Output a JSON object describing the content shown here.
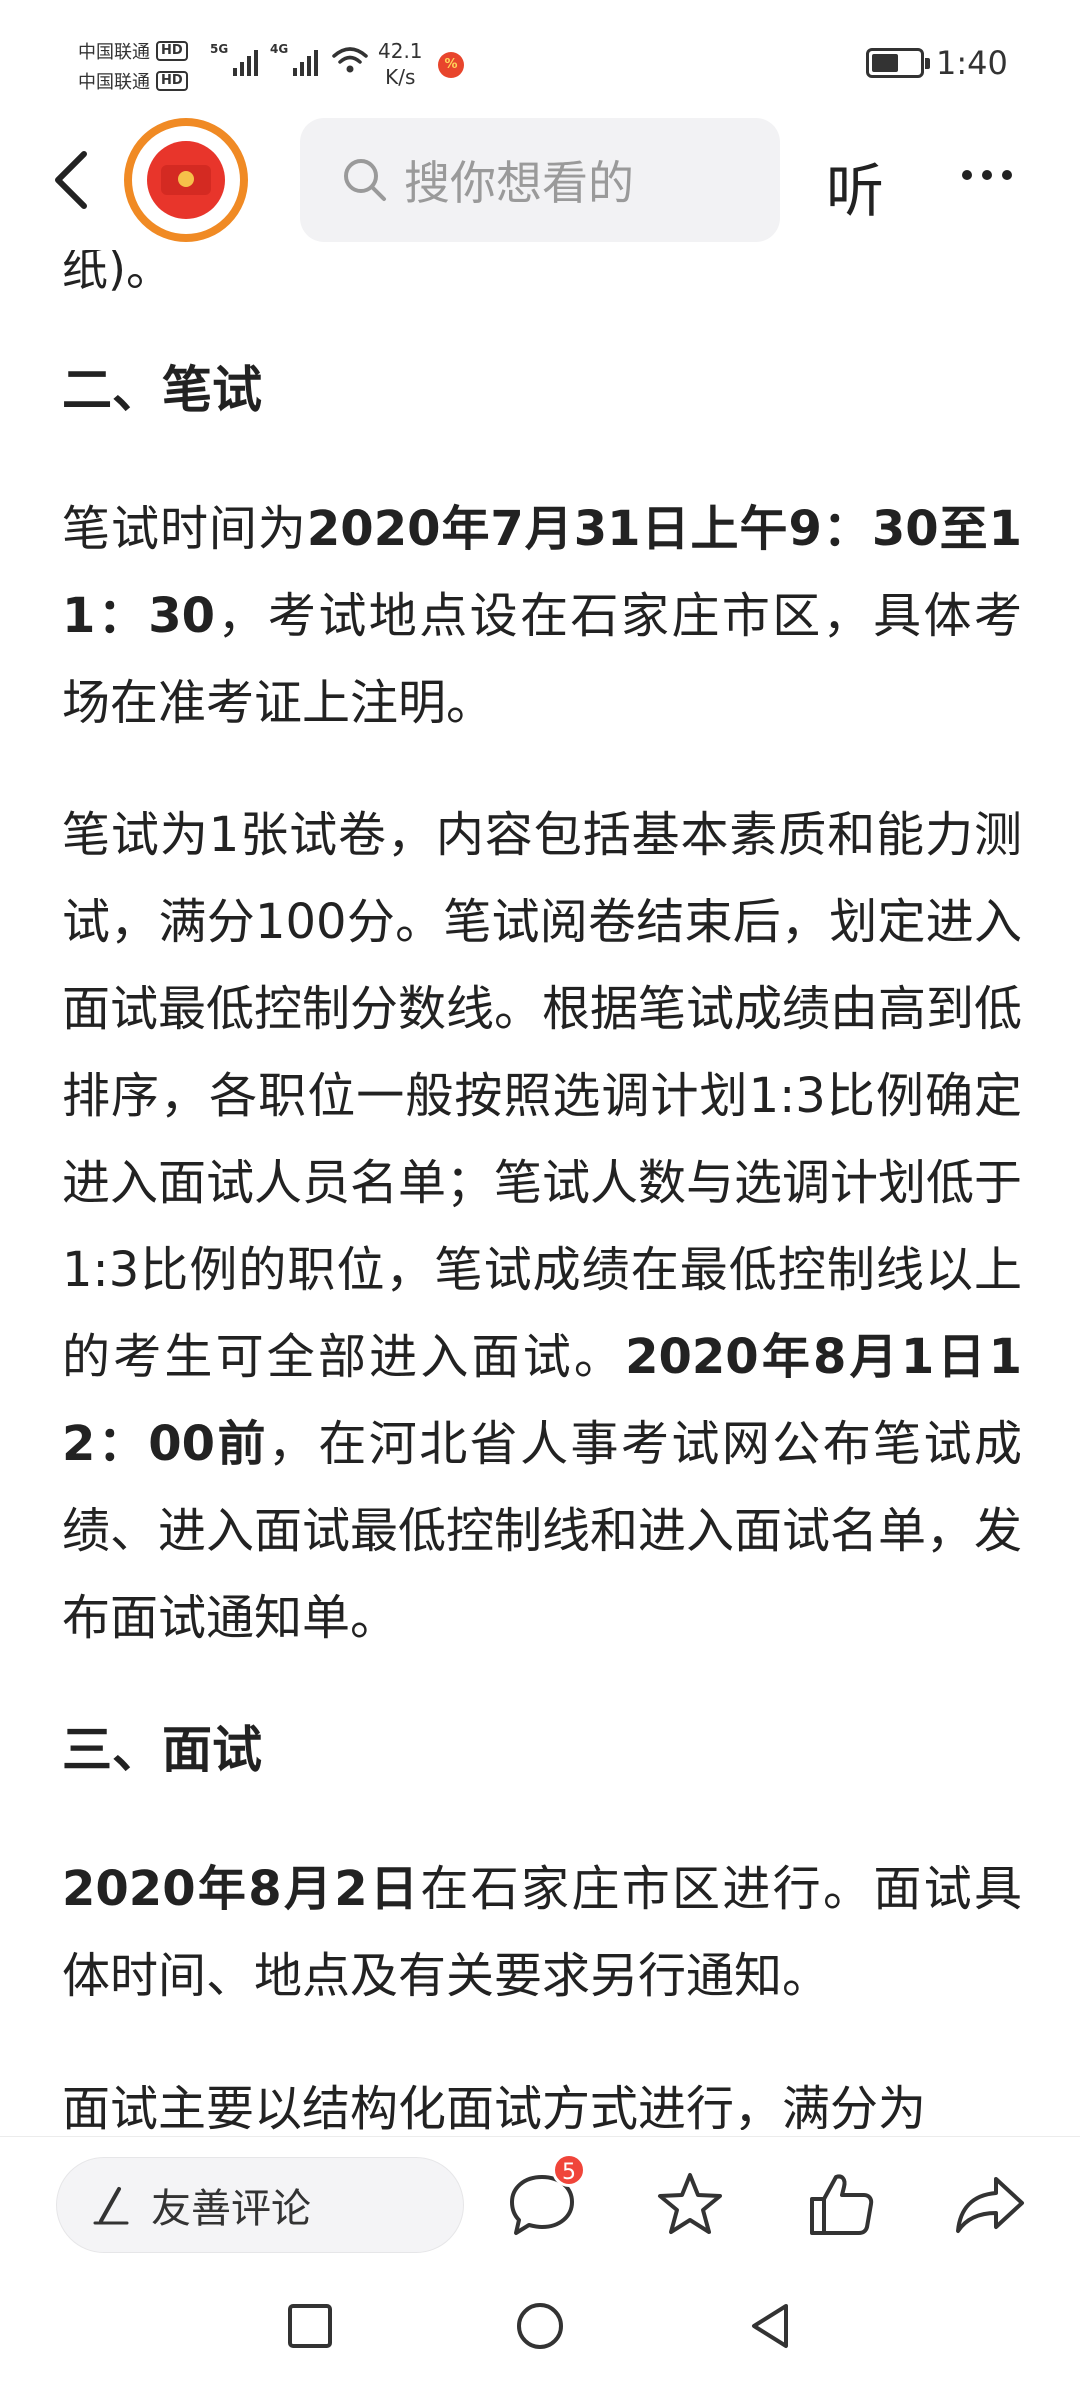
{
  "status_bar": {
    "carrier1": "中国联通",
    "carrier2": "中国联通",
    "hd": "HD",
    "sim1_tech": "5G",
    "sim2_tech": "4G",
    "net_speed_value": "42.1",
    "net_speed_unit": "K/s",
    "time": "1:40"
  },
  "nav": {
    "search_placeholder": "搜你想看的",
    "listen_label": "听"
  },
  "article": {
    "partial_top": "纸)。",
    "section2_heading": "二、笔试",
    "p1_bold": "笔试时间为",
    "p1_b": "2020年7月31日上午9：30至11：30",
    "p1_rest": "，考试地点设在石家庄市区，具体考场在准考证上注明。",
    "p2_text": "笔试为1张试卷，内容包括基本素质和能力测试，满分100分。笔试阅卷结束后，划定进入面试最低控制分数线。根据笔试成绩由高到低排序，各职位一般按照选调计划1:3比例确定进入面试人员名单；笔试人数与选调计划低于1:3比例的职位，笔试成绩在最低控制线以上的考生可全部进入面试。",
    "p2_b": "2020年8月1日12：00前",
    "p2_rest": "，在河北省人事考试网公布笔试成绩、进入面试最低控制线和进入面试名单，发布面试通知单。",
    "section3_heading": "三、面试",
    "p3_b": "2020年8月2日",
    "p3_rest": "在石家庄市区进行。面试具体时间、地点及有关要求另行通知。",
    "p4_partial": "面试主要以结构化面试方式进行，满分为"
  },
  "bottom_bar": {
    "comment_placeholder": "友善评论",
    "comment_count": "5"
  },
  "icons": {
    "back": "back-arrow-icon",
    "search": "search-icon",
    "more": "more-dots-icon",
    "pen": "pen-icon",
    "comment": "comment-bubble-icon",
    "star": "star-icon",
    "like": "thumbs-up-icon",
    "share": "share-arrow-icon"
  },
  "colors": {
    "accent_orange": "#f08a24",
    "red_envelope": "#e8352b",
    "badge_red": "#f0453a"
  }
}
